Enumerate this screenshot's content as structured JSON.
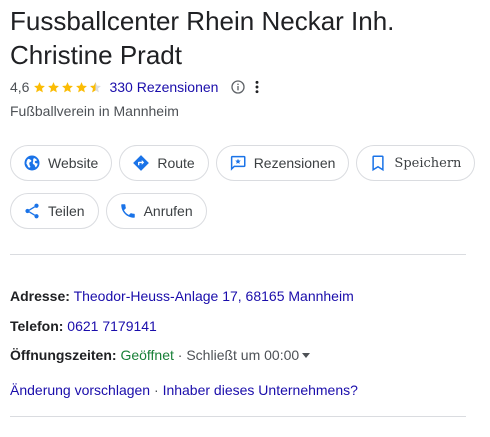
{
  "business": {
    "title_line1": "Fussballcenter Rhein Neckar Inh.",
    "title_line2": "Christine Pradt",
    "rating": "4,6",
    "stars": 4.5,
    "reviews_label": "330 Rezensionen",
    "category": "Fußballverein in Mannheim"
  },
  "icons": {
    "star": "star-icon",
    "info": "info-icon",
    "more": "more-vert-icon"
  },
  "actions": {
    "website": "Website",
    "route": "Route",
    "reviews": "Rezensionen",
    "save": "Speichern",
    "share": "Teilen",
    "call": "Anrufen"
  },
  "details": {
    "address_label": "Adresse:",
    "address_value": "Theodor-Heuss-Anlage 17, 68165 Mannheim",
    "phone_label": "Telefon:",
    "phone_value": "0621 7179141",
    "hours_label": "Öffnungszeiten:",
    "hours_status": "Geöffnet",
    "hours_sep": " · ",
    "hours_close": "Schließt um 00:00",
    "suggest_edit": "Änderung vorschlagen",
    "links_sep": " · ",
    "owner_link": "Inhaber dieses Unternehmens?"
  },
  "colors": {
    "link": "#1a0dab",
    "open": "#188038",
    "star": "#fbbc04",
    "icon_blue": "#1a73e8"
  }
}
